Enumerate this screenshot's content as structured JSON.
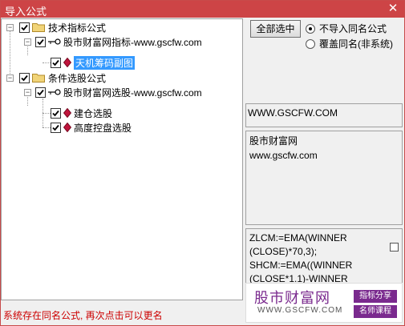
{
  "window": {
    "title": "导入公式",
    "close_glyph": "✕"
  },
  "tree": [
    {
      "label": "技术指标公式",
      "kind": "folder",
      "checked": true
    },
    {
      "label": "股市财富网指标-www.gscfw.com",
      "kind": "key",
      "checked": true
    },
    {
      "label": "天机筹码副图",
      "kind": "formula",
      "checked": true,
      "selected": true
    },
    {
      "label": "条件选股公式",
      "kind": "folder",
      "checked": true
    },
    {
      "label": "股市财富网选股-www.gscfw.com",
      "kind": "key",
      "checked": true
    },
    {
      "label": "建仓选股",
      "kind": "formula",
      "checked": true
    },
    {
      "label": "高度控盘选股",
      "kind": "formula",
      "checked": true
    }
  ],
  "select_all_label": "全部选中",
  "options": [
    {
      "label": "不导入同名公式",
      "selected": true
    },
    {
      "label": "覆盖同名(非系统)",
      "selected": false
    }
  ],
  "site_box": "WWW.GSCFW.COM",
  "description": [
    "股市财富网",
    "www.gscfw.com"
  ],
  "code_lines": [
    "ZLCM:=EMA(WINNER",
    "(CLOSE)*70,3);",
    "SHCM:=EMA((WINNER",
    "(CLOSE*1.1)-WINNER"
  ],
  "status_text": "系统存在同名公式, 再次点击可以更名",
  "watermark": {
    "title": "股市财富网",
    "url": "WWW.GSCFW.COM",
    "tag1": "指标分享",
    "tag2": "名师课程"
  },
  "colors": {
    "title_bar": "#cd4446",
    "selection": "#3399ff",
    "status": "#cc0000",
    "brand_purple": "#7a2a8e"
  }
}
